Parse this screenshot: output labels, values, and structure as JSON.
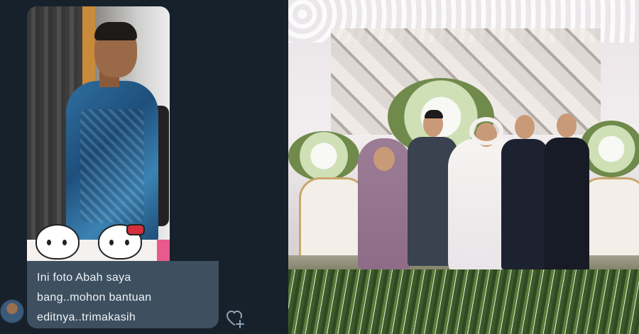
{
  "chat": {
    "message": {
      "text_line1": "Ini foto Abah saya",
      "text_line2": "bang..mohon bantuan",
      "text_line3": "editnya..trimakasih"
    },
    "icons": {
      "avatar": "user-avatar",
      "reaction": "heart-plus-icon"
    },
    "colors": {
      "background": "#17212b",
      "bubble": "#3e5060",
      "text": "#eef2f5"
    }
  },
  "photo": {
    "subject": "wedding group photo"
  }
}
